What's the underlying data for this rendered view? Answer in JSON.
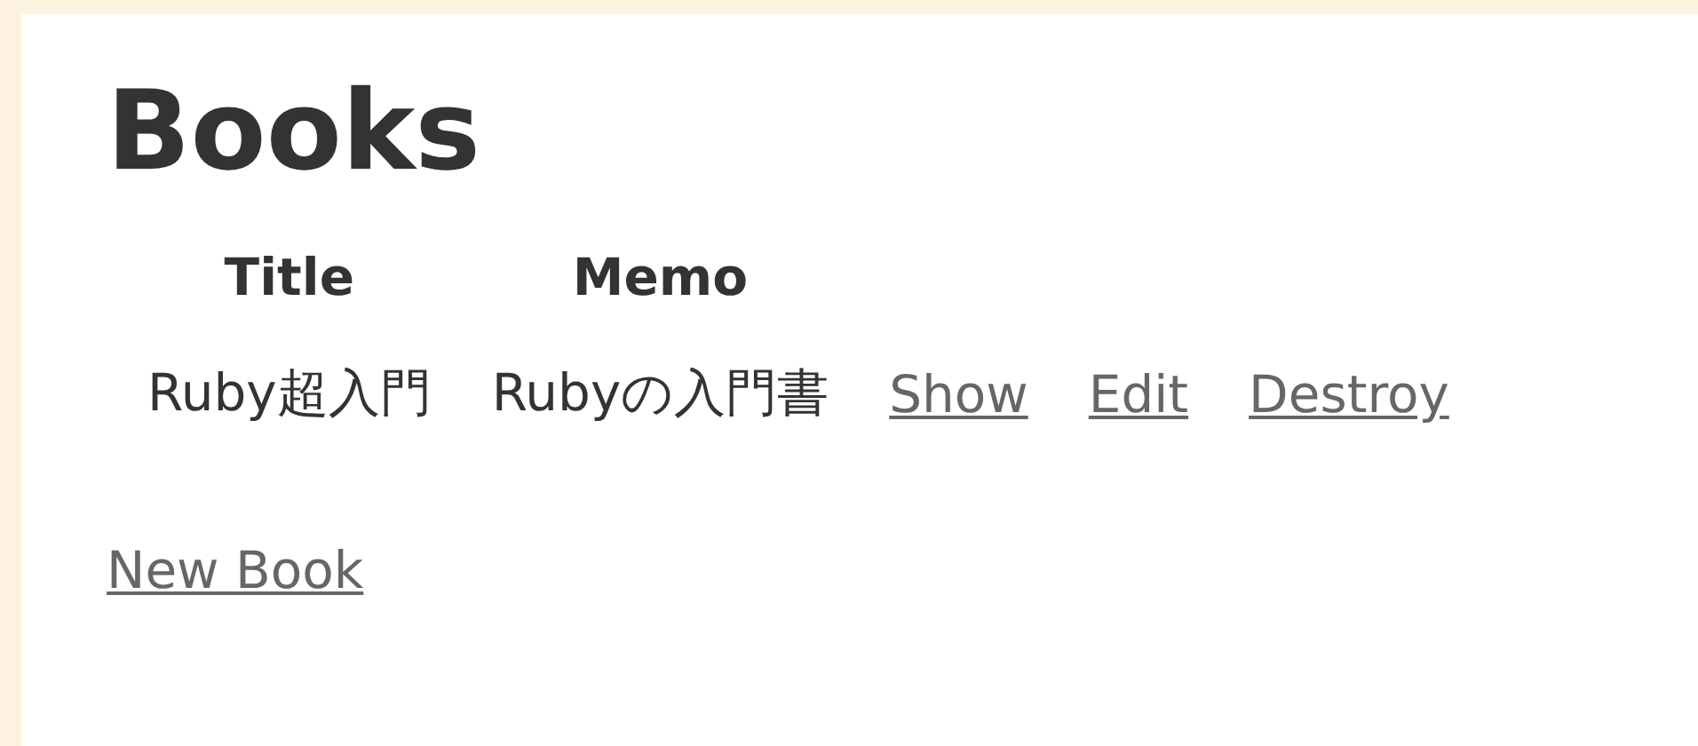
{
  "heading": "Books",
  "table": {
    "columns": [
      "Title",
      "Memo"
    ],
    "rows": [
      {
        "cells": [
          "Ruby超入門",
          "Rubyの入門書"
        ],
        "actions": [
          "Show",
          "Edit",
          "Destroy"
        ]
      }
    ]
  },
  "new_link": "New Book"
}
